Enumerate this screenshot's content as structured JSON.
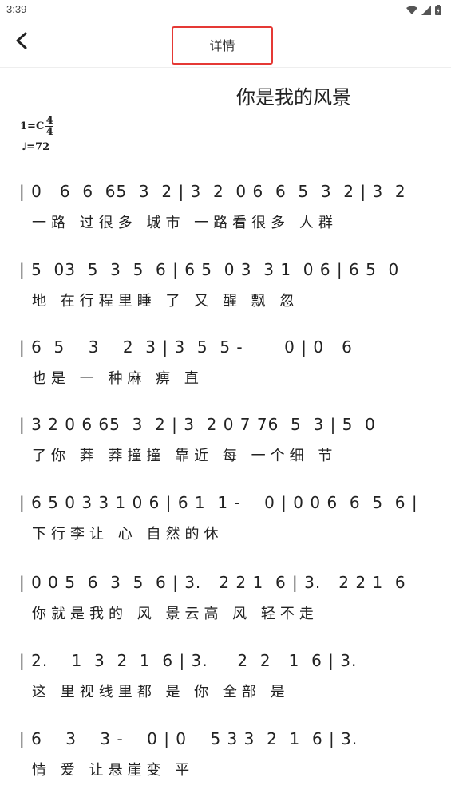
{
  "status_bar": {
    "time": "3:39",
    "icons": [
      "wifi-icon",
      "signal-icon",
      "battery-icon"
    ]
  },
  "app_bar": {
    "back_icon": "chevron-left-icon",
    "title": "详情"
  },
  "song": {
    "title": "你是我的风景",
    "key_label": "1=C",
    "time_sig_top": "4",
    "time_sig_bottom": "4",
    "tempo": "♩=72"
  },
  "rows": [
    {
      "notes": "| 0   6  6  65  3  2 | 3  2  0 6  6  5  3  2 | 3  2",
      "lyrics": "一路 过很多 城市 一路看很多 人群"
    },
    {
      "notes": "| 5  03  5  3  5  6 | 6 5  0 3  3 1  0 6 | 6 5  0",
      "lyrics": "地 在行程里睡 了 又 醒 飘 忽"
    },
    {
      "notes": "| 6  5    3    2  3 | 3  5  5 -       0 | 0   6",
      "lyrics": "也是 一 种麻 痹 直"
    },
    {
      "notes": "| 3 2 0 6 65  3  2 | 3  2 0 7 76  5  3 | 5  0",
      "lyrics": "了你 莽 莽撞撞 靠近 每 一个细 节"
    },
    {
      "notes": "| 6 5 0 3 3 1 0 6 | 6 1  1 -    0 | 0 0 6  6  5  6 |",
      "lyrics": "下行李让 心 自然的休"
    },
    {
      "notes": "| 0 0 5  6  3  5  6 | 3.   2 2 1  6 | 3.   2 2 1  6",
      "lyrics": "你就是我的 风 景云高 风 轻不走"
    },
    {
      "notes": "| 2.    1  3  2  1  6 | 3.     2  2   1  6 | 3.",
      "lyrics": "这 里视线里都 是 你 全部 是"
    },
    {
      "notes": "| 6    3    3 -    0 | 0    5 3 3  2  1  6 | 3.",
      "lyrics": "情 爱 让悬崖变 平"
    }
  ]
}
